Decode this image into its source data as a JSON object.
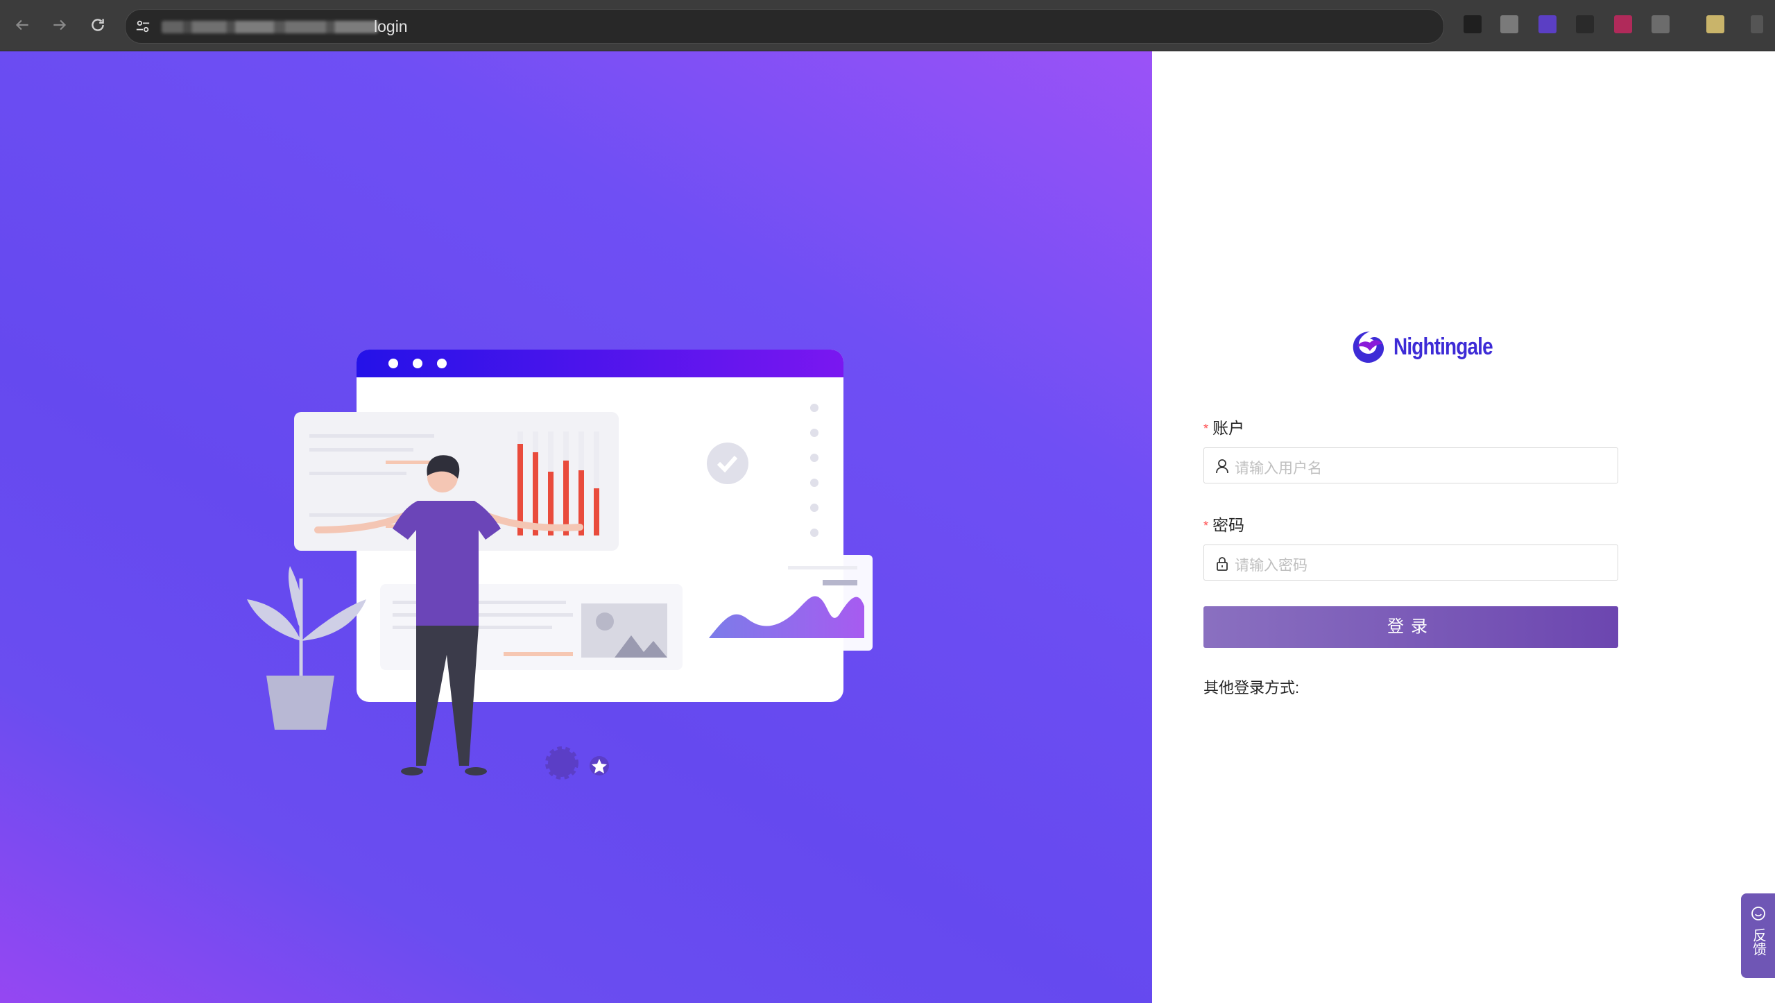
{
  "browser": {
    "url_visible": "login",
    "extension_colors": [
      "#1f1f1f",
      "#7a7a7a",
      "#5b3fc4",
      "#2a2a2a",
      "#b02a5a",
      "#6c6c6c",
      "#c9b46a"
    ]
  },
  "hero": {
    "illustration": "analytics-dashboard-illustration",
    "colors": {
      "accent": "#4b14f0",
      "bars": "#e94b3c",
      "area": "#8b5cf6"
    }
  },
  "login": {
    "brand_name": "Nightingale",
    "account_label": "账户",
    "account_placeholder": "请输入用户名",
    "password_label": "密码",
    "password_placeholder": "请输入密码",
    "required_mark": "*",
    "submit_label": "登录",
    "other_methods_label": "其他登录方式:"
  },
  "feedback": {
    "label": "反馈"
  }
}
